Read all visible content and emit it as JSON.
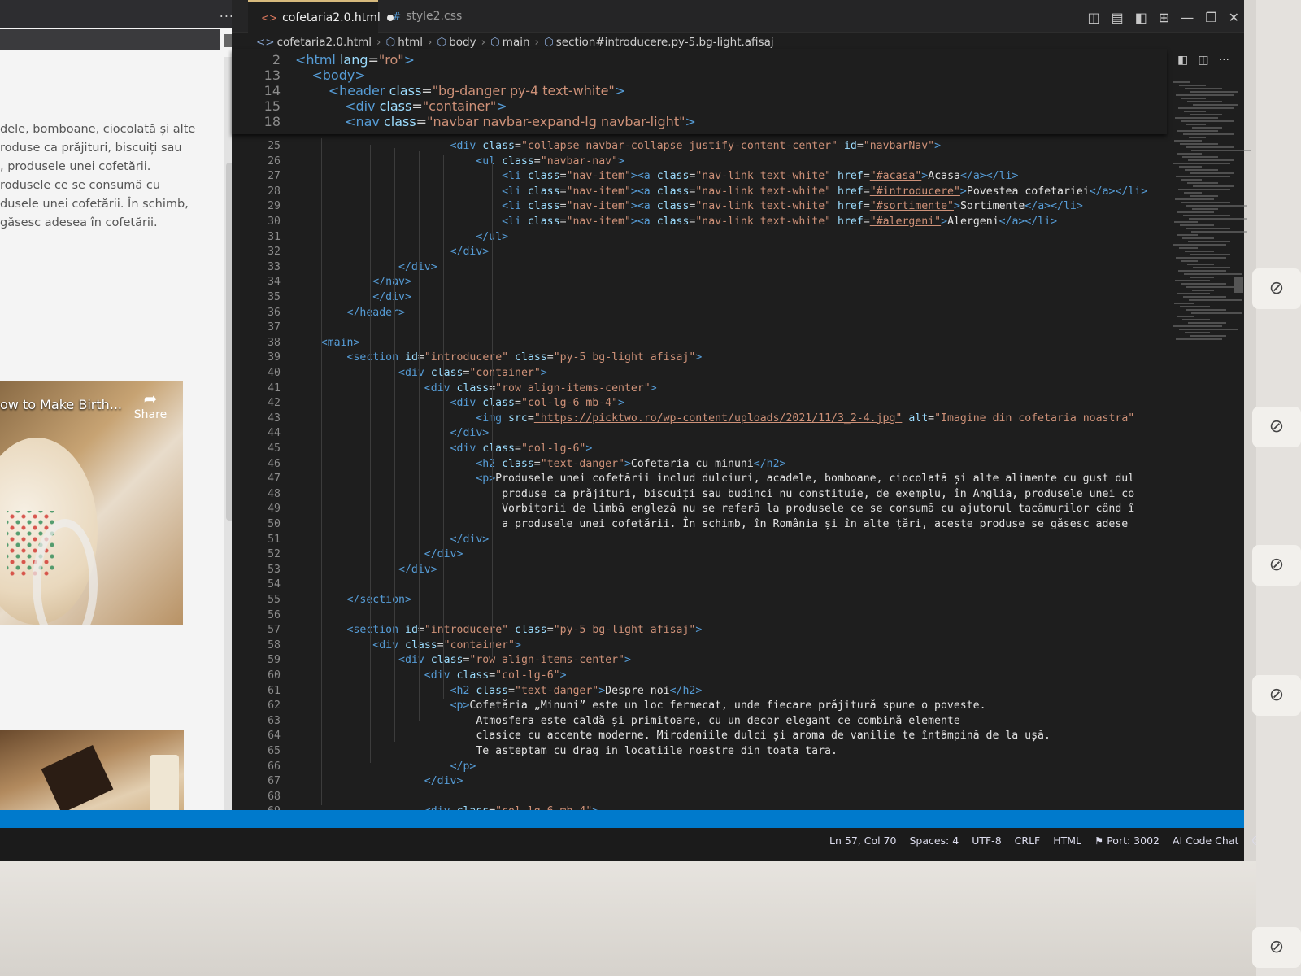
{
  "preview": {
    "more": "...",
    "paragraph": [
      "dele, bomboane, ciocolată și alte",
      "roduse ca prăjituri, biscuiți sau",
      ", produsele unei cofetării.",
      "rodusele ce se consumă cu",
      "dusele unei cofetării. În schimb,",
      "găsesc adesea în cofetării."
    ],
    "video_title": "ow to Make Birth...",
    "share_label": "Share",
    "share_icon": "share-arrow-icon"
  },
  "tabs": [
    {
      "label": "cofetaria2.0.html",
      "icon": "html-file-icon",
      "dirty": true
    },
    {
      "label": "style2.css",
      "icon": "css-file-icon",
      "dirty": false
    }
  ],
  "breadcrumb": [
    "cofetaria2.0.html",
    "html",
    "body",
    "main",
    "section#introducere.py-5.bg-light.afisaj"
  ],
  "window_controls": [
    "layout-icon",
    "panel-icon",
    "split-icon",
    "grid-icon",
    "minimize-icon",
    "restore-icon",
    "close-icon"
  ],
  "sticky_lines": [
    {
      "n": "2",
      "html": "<span class=\"t\">&lt;html</span> <span class=\"a\">lang</span>=<span class=\"s\">\"ro\"</span><span class=\"t\">&gt;</span>"
    },
    {
      "n": "13",
      "html": "    <span class=\"t\">&lt;body&gt;</span>"
    },
    {
      "n": "14",
      "html": "        <span class=\"t\">&lt;header</span> <span class=\"a\">class</span>=<span class=\"s\">\"bg-danger py-4 text-white\"</span><span class=\"t\">&gt;</span>"
    },
    {
      "n": "15",
      "html": "            <span class=\"t\">&lt;div</span> <span class=\"a\">class</span>=<span class=\"s\">\"container\"</span><span class=\"t\">&gt;</span>"
    },
    {
      "n": "18",
      "html": "            <span class=\"t\">&lt;nav</span> <span class=\"a\">class</span>=<span class=\"s\">\"navbar navbar-expand-lg navbar-light\"</span><span class=\"t\">&gt;</span>"
    }
  ],
  "code_lines": [
    {
      "n": "25",
      "html": "                        <span class=\"t\">&lt;div</span> <span class=\"a\">class</span>=<span class=\"s\">\"collapse navbar-collapse justify-content-center\"</span> <span class=\"a\">id</span>=<span class=\"s\">\"navbarNav\"</span><span class=\"t\">&gt;</span>"
    },
    {
      "n": "26",
      "html": "                            <span class=\"t\">&lt;ul</span> <span class=\"a\">class</span>=<span class=\"s\">\"navbar-nav\"</span><span class=\"t\">&gt;</span>"
    },
    {
      "n": "27",
      "html": "                                <span class=\"t\">&lt;li</span> <span class=\"a\">class</span>=<span class=\"s\">\"nav-item\"</span><span class=\"t\">&gt;&lt;a</span> <span class=\"a\">class</span>=<span class=\"s\">\"nav-link text-white\"</span> <span class=\"a\">href</span>=<span class=\"u\">\"#acasa\"</span><span class=\"t\">&gt;</span><span class=\"tx\">Acasa</span><span class=\"t\">&lt;/a&gt;&lt;/li&gt;</span>"
    },
    {
      "n": "28",
      "html": "                                <span class=\"t\">&lt;li</span> <span class=\"a\">class</span>=<span class=\"s\">\"nav-item\"</span><span class=\"t\">&gt;&lt;a</span> <span class=\"a\">class</span>=<span class=\"s\">\"nav-link text-white\"</span> <span class=\"a\">href</span>=<span class=\"u\">\"#introducere\"</span><span class=\"t\">&gt;</span><span class=\"tx\">Povestea cofetariei</span><span class=\"t\">&lt;/a&gt;&lt;/li&gt;</span>"
    },
    {
      "n": "29",
      "html": "                                <span class=\"t\">&lt;li</span> <span class=\"a\">class</span>=<span class=\"s\">\"nav-item\"</span><span class=\"t\">&gt;&lt;a</span> <span class=\"a\">class</span>=<span class=\"s\">\"nav-link text-white\"</span> <span class=\"a\">href</span>=<span class=\"u\">\"#sortimente\"</span><span class=\"t\">&gt;</span><span class=\"tx\">Sortimente</span><span class=\"t\">&lt;/a&gt;&lt;/li&gt;</span>"
    },
    {
      "n": "30",
      "html": "                                <span class=\"t\">&lt;li</span> <span class=\"a\">class</span>=<span class=\"s\">\"nav-item\"</span><span class=\"t\">&gt;&lt;a</span> <span class=\"a\">class</span>=<span class=\"s\">\"nav-link text-white\"</span> <span class=\"a\">href</span>=<span class=\"u\">\"#alergeni\"</span><span class=\"t\">&gt;</span><span class=\"tx\">Alergeni</span><span class=\"t\">&lt;/a&gt;&lt;/li&gt;</span>"
    },
    {
      "n": "31",
      "html": "                            <span class=\"t\">&lt;/ul&gt;</span>"
    },
    {
      "n": "32",
      "html": "                        <span class=\"t\">&lt;/div&gt;</span>"
    },
    {
      "n": "33",
      "html": "                <span class=\"t\">&lt;/div&gt;</span>"
    },
    {
      "n": "34",
      "html": "            <span class=\"t\">&lt;/nav&gt;</span>"
    },
    {
      "n": "35",
      "html": "            <span class=\"t\">&lt;/div&gt;</span>"
    },
    {
      "n": "36",
      "html": "        <span class=\"t\">&lt;/header&gt;</span>"
    },
    {
      "n": "37",
      "html": ""
    },
    {
      "n": "38",
      "html": "    <span class=\"t\">&lt;main&gt;</span>"
    },
    {
      "n": "39",
      "html": "        <span class=\"t\">&lt;section</span> <span class=\"a\">id</span>=<span class=\"s\">\"introducere\"</span> <span class=\"a\">class</span>=<span class=\"s\">\"py-5 bg-light afisaj\"</span><span class=\"t\">&gt;</span>"
    },
    {
      "n": "40",
      "html": "                <span class=\"t\">&lt;div</span> <span class=\"a\">class</span>=<span class=\"s\">\"container\"</span><span class=\"t\">&gt;</span>"
    },
    {
      "n": "41",
      "html": "                    <span class=\"t\">&lt;div</span> <span class=\"a\">class</span>=<span class=\"s\">\"row align-items-center\"</span><span class=\"t\">&gt;</span>"
    },
    {
      "n": "42",
      "html": "                        <span class=\"t\">&lt;div</span> <span class=\"a\">class</span>=<span class=\"s\">\"col-lg-6 mb-4\"</span><span class=\"t\">&gt;</span>"
    },
    {
      "n": "43",
      "html": "                            <span class=\"t\">&lt;img</span> <span class=\"a\">src</span>=<span class=\"u\">\"https://picktwo.ro/wp-content/uploads/2021/11/3_2-4.jpg\"</span> <span class=\"a\">alt</span>=<span class=\"s\">\"Imagine din cofetaria noastra\"</span>"
    },
    {
      "n": "44",
      "html": "                        <span class=\"t\">&lt;/div&gt;</span>"
    },
    {
      "n": "45",
      "html": "                        <span class=\"t\">&lt;div</span> <span class=\"a\">class</span>=<span class=\"s\">\"col-lg-6\"</span><span class=\"t\">&gt;</span>"
    },
    {
      "n": "46",
      "html": "                            <span class=\"t\">&lt;h2</span> <span class=\"a\">class</span>=<span class=\"s\">\"text-danger\"</span><span class=\"t\">&gt;</span><span class=\"tx\">Cofetaria cu minuni</span><span class=\"t\">&lt;/h2&gt;</span>"
    },
    {
      "n": "47",
      "html": "                            <span class=\"t\">&lt;p&gt;</span><span class=\"tx\">Produsele unei cofetării includ dulciuri, acadele, bomboane, ciocolată și alte alimente cu gust dul</span>"
    },
    {
      "n": "48",
      "html": "                                <span class=\"tx\">produse ca prăjituri, biscuiți sau budinci nu constituie, de exemplu, în Anglia, produsele unei co</span>"
    },
    {
      "n": "49",
      "html": "                                <span class=\"tx\">Vorbitorii de limbă engleză nu se referă la produsele ce se consumă cu ajutorul tacâmurilor când î</span>"
    },
    {
      "n": "50",
      "html": "                                <span class=\"tx\">a produsele unei cofetării. În schimb, în România și în alte țări, aceste produse se găsesc adese</span>"
    },
    {
      "n": "51",
      "html": "                        <span class=\"t\">&lt;/div&gt;</span>"
    },
    {
      "n": "52",
      "html": "                    <span class=\"t\">&lt;/div&gt;</span>"
    },
    {
      "n": "53",
      "html": "                <span class=\"t\">&lt;/div&gt;</span>"
    },
    {
      "n": "54",
      "html": ""
    },
    {
      "n": "55",
      "html": "        <span class=\"t\">&lt;/section&gt;</span>"
    },
    {
      "n": "56",
      "html": ""
    },
    {
      "n": "57",
      "html": "        <span class=\"t\">&lt;section</span> <span class=\"a\">id</span>=<span class=\"s\">\"introducere\"</span> <span class=\"a\">class</span>=<span class=\"s\">\"py-5 bg-light afisaj\"</span><span class=\"t\">&gt;</span>"
    },
    {
      "n": "58",
      "html": "            <span class=\"t\">&lt;div</span> <span class=\"a\">class</span>=<span class=\"s\">\"container\"</span><span class=\"t\">&gt;</span>"
    },
    {
      "n": "59",
      "html": "                <span class=\"t\">&lt;div</span> <span class=\"a\">class</span>=<span class=\"s\">\"row align-items-center\"</span><span class=\"t\">&gt;</span>"
    },
    {
      "n": "60",
      "html": "                    <span class=\"t\">&lt;div</span> <span class=\"a\">class</span>=<span class=\"s\">\"col-lg-6\"</span><span class=\"t\">&gt;</span>"
    },
    {
      "n": "61",
      "html": "                        <span class=\"t\">&lt;h2</span> <span class=\"a\">class</span>=<span class=\"s\">\"text-danger\"</span><span class=\"t\">&gt;</span><span class=\"tx\">Despre noi</span><span class=\"t\">&lt;/h2&gt;</span>"
    },
    {
      "n": "62",
      "html": "                        <span class=\"t\">&lt;p&gt;</span><span class=\"tx\">Cofetăria „Minuni” este un loc fermecat, unde fiecare prăjitură spune o poveste.</span>"
    },
    {
      "n": "63",
      "html": "                            <span class=\"tx\">Atmosfera este caldă și primitoare, cu un decor elegant ce combină elemente</span>"
    },
    {
      "n": "64",
      "html": "                            <span class=\"tx\">clasice cu accente moderne. Mirodeniile dulci și aroma de vanilie te întâmpină de la ușă.</span>"
    },
    {
      "n": "65",
      "html": "                            <span class=\"tx\">Te asteptam cu drag in locatiile noastre din toata tara.</span>"
    },
    {
      "n": "66",
      "html": "                        <span class=\"t\">&lt;/p&gt;</span>"
    },
    {
      "n": "67",
      "html": "                    <span class=\"t\">&lt;/div&gt;</span>"
    },
    {
      "n": "68",
      "html": ""
    },
    {
      "n": "69",
      "html": "                    <span class=\"t\">&lt;div</span> <span class=\"a\">class</span>=<span class=\"s\">\"col-lg-6 mb-4\"</span><span class=\"t\">&gt;</span>"
    }
  ],
  "status": {
    "position": "Ln 57, Col 70",
    "spaces": "Spaces: 4",
    "encoding": "UTF-8",
    "eol": "CRLF",
    "language": "HTML",
    "port": "Port: 3002",
    "chat": "AI Code Chat"
  },
  "colors": {
    "editor_bg": "#1e1e1e",
    "tag": "#569cd6",
    "attr": "#9cdcfe",
    "string": "#ce9178",
    "statusbar": "#007acc"
  },
  "meeting_icons": [
    "mic-off-icon",
    "mic-off-icon",
    "mic-off-icon",
    "mic-off-icon",
    "mic-off-icon"
  ]
}
